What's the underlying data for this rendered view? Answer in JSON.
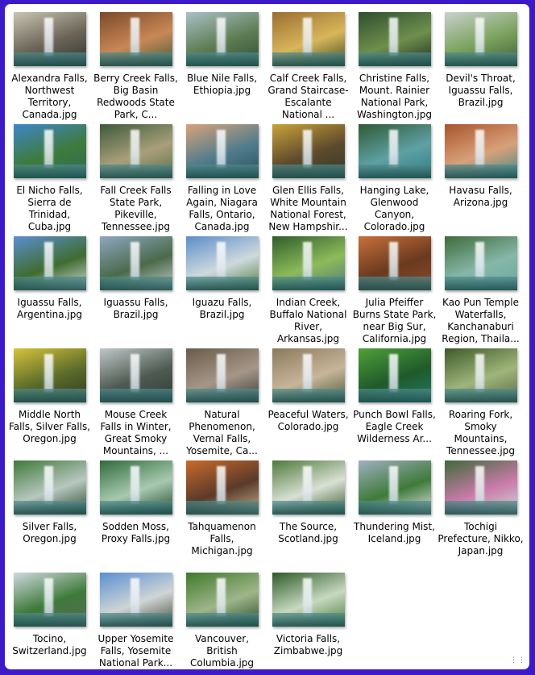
{
  "items": [
    {
      "label": "Alexandra Falls, Northwest Territory, Canada.jpg",
      "colors": [
        "#c9c4b2",
        "#6a6457",
        "#2f3330"
      ]
    },
    {
      "label": "Berry Creek Falls, Big Basin Redwoods State Park, C...",
      "colors": [
        "#7b4a2a",
        "#c98756",
        "#3f5f3a"
      ]
    },
    {
      "label": "Blue Nile Falls, Ethiopia.jpg",
      "colors": [
        "#aac0c7",
        "#5d7c52",
        "#2f4f37"
      ]
    },
    {
      "label": "Calf Creek Falls, Grand Staircase-Escalante National ...",
      "colors": [
        "#9a6d31",
        "#d8b65a",
        "#3f4a24"
      ]
    },
    {
      "label": "Christine Falls, Mount. Rainier National Park, Washington.jpg",
      "colors": [
        "#2f4f2f",
        "#6e8f4c",
        "#1e2d1f"
      ]
    },
    {
      "label": "Devil's Throat, Iguassu Falls, Brazil.jpg",
      "colors": [
        "#c9d1cf",
        "#7aa15b",
        "#3f5c3b"
      ]
    },
    {
      "label": "El Nicho Falls, Sierra de Trinidad, Cuba.jpg",
      "colors": [
        "#3f86c9",
        "#3e7b3b",
        "#2f6b59"
      ]
    },
    {
      "label": "Fall Creek Falls State Park, Pikeville, Tennessee.jpg",
      "colors": [
        "#3c5a3a",
        "#a89f7a",
        "#5d6f48"
      ]
    },
    {
      "label": "Falling in Love Again, Niagara Falls, Ontario, Canada.jpg",
      "colors": [
        "#d9a27a",
        "#4f7c8c",
        "#2c4e5a"
      ]
    },
    {
      "label": "Glen Ellis Falls, White Mountain National Forest, New Hampshir...",
      "colors": [
        "#c9a23a",
        "#5e4a2c",
        "#2e3b2b"
      ]
    },
    {
      "label": "Hanging Lake, Glenwood Canyon, Colorado.jpg",
      "colors": [
        "#2f5a35",
        "#5fa0a4",
        "#2a7f86"
      ]
    },
    {
      "label": "Havasu Falls, Arizona.jpg",
      "colors": [
        "#a8552c",
        "#d9a07a",
        "#3c8a88"
      ]
    },
    {
      "label": "Iguassu Falls, Argentina.jpg",
      "colors": [
        "#5c8fd1",
        "#3f6c2f",
        "#d5dde0"
      ]
    },
    {
      "label": "Iguassu Falls, Brazil.jpg",
      "colors": [
        "#8da7bf",
        "#4b6a4b",
        "#c8d0cb"
      ]
    },
    {
      "label": "Iguazu Falls, Brazil.jpg",
      "colors": [
        "#5b8ec9",
        "#cfd9dd",
        "#4f7c3c"
      ]
    },
    {
      "label": "Indian Creek, Buffalo National River, Arkansas.jpg",
      "colors": [
        "#2f5d2a",
        "#8dbb5a",
        "#4d7a7a"
      ]
    },
    {
      "label": "Julia Pfeiffer Burns State Park, near Big Sur, California.jpg",
      "colors": [
        "#c9703a",
        "#6a3a1f",
        "#8a4b2c"
      ]
    },
    {
      "label": "Kao Pun Temple Waterfalls, Kanchanaburi Region, Thaila...",
      "colors": [
        "#3f6b3a",
        "#86b7a8",
        "#6aa6a0"
      ]
    },
    {
      "label": "Middle North Falls, Silver Falls, Oregon.jpg",
      "colors": [
        "#d8c23a",
        "#5a6b2a",
        "#2f3a1f"
      ]
    },
    {
      "label": "Mouse Creek Falls in Winter, Great Smoky Mountains, ...",
      "colors": [
        "#bfc7c9",
        "#4f5b52",
        "#2f3a35"
      ]
    },
    {
      "label": "Natural Phenomenon, Vernal Falls, Yosemite, Ca...",
      "colors": [
        "#6a5a4a",
        "#a59787",
        "#3a3a3a"
      ]
    },
    {
      "label": "Peaceful Waters, Colorado.jpg",
      "colors": [
        "#8a7a5a",
        "#c7b59a",
        "#4a5a3a"
      ]
    },
    {
      "label": "Punch Bowl Falls, Eagle Creek Wilderness Ar...",
      "colors": [
        "#4fa03a",
        "#1f5a2a",
        "#1f7a6a"
      ]
    },
    {
      "label": "Roaring Fork, Smoky Mountains, Tennessee.jpg",
      "colors": [
        "#3f5a2a",
        "#9fb57a",
        "#5a6a4a"
      ]
    },
    {
      "label": "Silver Falls, Oregon.jpg",
      "colors": [
        "#3f7a3a",
        "#b8c7c0",
        "#2a4a2a"
      ]
    },
    {
      "label": "Sodden Moss, Proxy Falls.jpg",
      "colors": [
        "#2f6b3a",
        "#a8c9b0",
        "#1f4a2a"
      ]
    },
    {
      "label": "Tahquamenon Falls, Michigan.jpg",
      "colors": [
        "#c96a2a",
        "#5a3a2a",
        "#c7b08a"
      ]
    },
    {
      "label": "The Source, Scotland.jpg",
      "colors": [
        "#4f7a3a",
        "#d9e0d5",
        "#3a5a2a"
      ]
    },
    {
      "label": "Thundering Mist, Iceland.jpg",
      "colors": [
        "#9fb0c0",
        "#3f7a3a",
        "#e0e6e8"
      ]
    },
    {
      "label": "Tochigi Prefecture, Nikko, Japan.jpg",
      "colors": [
        "#3f6a3a",
        "#c97aa8",
        "#cfd9d5"
      ]
    },
    {
      "label": "Tocino, Switzerland.jpg",
      "colors": [
        "#cfd9e0",
        "#3f7a3a",
        "#5a6a5a"
      ]
    },
    {
      "label": "Upper Yosemite Falls, Yosemite National Park...",
      "colors": [
        "#5a8fd1",
        "#cfd5d5",
        "#4a4a3a"
      ]
    },
    {
      "label": "Vancouver, British Columbia.jpg",
      "colors": [
        "#3f7a2a",
        "#9fb58a",
        "#2a4a2a"
      ]
    },
    {
      "label": "Victoria Falls, Zimbabwe.jpg",
      "colors": [
        "#2f5a2a",
        "#c7d9c0",
        "#4a7a3a"
      ]
    }
  ]
}
